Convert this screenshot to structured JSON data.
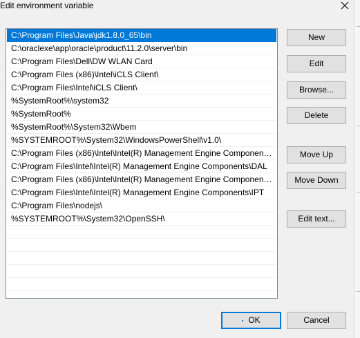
{
  "window": {
    "title": "Edit environment variable"
  },
  "list": {
    "items": [
      "C:\\Program Files\\Java\\jdk1.8.0_65\\bin",
      "C:\\oraclexe\\app\\oracle\\product\\11.2.0\\server\\bin",
      "C:\\Program Files\\Dell\\DW WLAN Card",
      "C:\\Program Files (x86)\\Intel\\iCLS Client\\",
      "C:\\Program Files\\Intel\\iCLS Client\\",
      "%SystemRoot%\\system32",
      "%SystemRoot%",
      "%SystemRoot%\\System32\\Wbem",
      "%SYSTEMROOT%\\System32\\WindowsPowerShell\\v1.0\\",
      "C:\\Program Files (x86)\\Intel\\Intel(R) Management Engine Component...",
      "C:\\Program Files\\Intel\\Intel(R) Management Engine Components\\DAL",
      "C:\\Program Files (x86)\\Intel\\Intel(R) Management Engine Component...",
      "C:\\Program Files\\Intel\\Intel(R) Management Engine Components\\IPT",
      "C:\\Program Files\\nodejs\\",
      "%SYSTEMROOT%\\System32\\OpenSSH\\"
    ],
    "selected_index": 0
  },
  "buttons": {
    "new": "New",
    "edit": "Edit",
    "browse": "Browse...",
    "delete": "Delete",
    "move_up": "Move Up",
    "move_down": "Move Down",
    "edit_text": "Edit text...",
    "ok": "OK",
    "cancel": "Cancel"
  },
  "colors": {
    "selection": "#0078d7",
    "accent": "#0078d7"
  },
  "icons": {
    "close": "close-icon"
  }
}
